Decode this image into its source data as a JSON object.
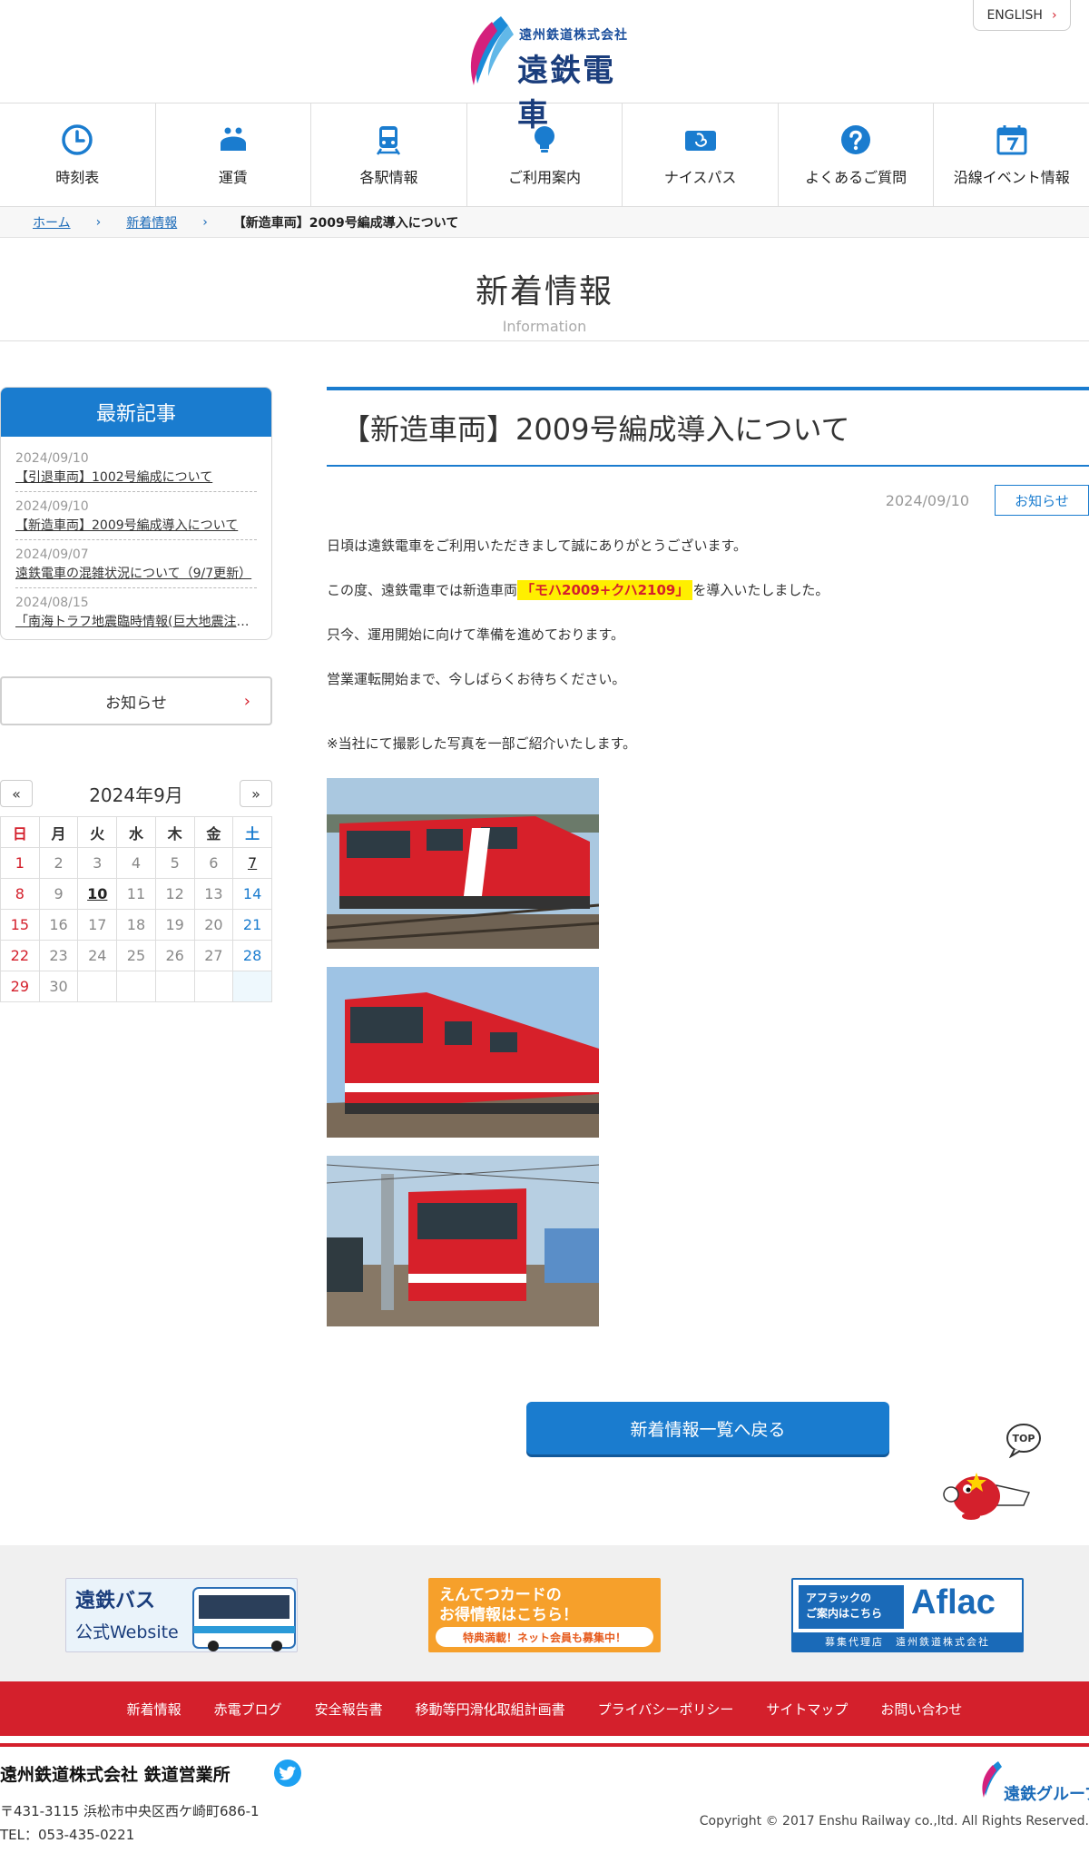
{
  "header": {
    "logo_small": "遠州鉄道株式会社",
    "logo_big": "遠鉄電車",
    "english_label": "ENGLISH"
  },
  "nav": [
    {
      "label": "時刻表",
      "icon": "clock-icon"
    },
    {
      "label": "運賃",
      "icon": "purse-icon"
    },
    {
      "label": "各駅情報",
      "icon": "train-icon"
    },
    {
      "label": "ご利用案内",
      "icon": "lightbulb-icon"
    },
    {
      "label": "ナイスパス",
      "icon": "ic-card-icon"
    },
    {
      "label": "よくあるご質問",
      "icon": "question-icon"
    },
    {
      "label": "沿線イベント情報",
      "icon": "calendar-icon"
    }
  ],
  "breadcrumb": {
    "home": "ホーム",
    "news": "新着情報",
    "current": "【新造車両】2009号編成導入について"
  },
  "page_title": {
    "title": "新着情報",
    "subtitle": "Information"
  },
  "sidebar": {
    "recent_heading": "最新記事",
    "recent": [
      {
        "date": "2024/09/10",
        "title": "【引退車両】1002号編成について"
      },
      {
        "date": "2024/09/10",
        "title": "【新造車両】2009号編成導入について"
      },
      {
        "date": "2024/09/07",
        "title": "遠鉄電車の混雑状況について（9/7更新）"
      },
      {
        "date": "2024/08/15",
        "title": "「南海トラフ地震臨時情報(巨大地震注意)」"
      }
    ],
    "category_button": "お知らせ",
    "calendar": {
      "title": "2024年9月",
      "prev": "«",
      "next": "»",
      "weekdays": [
        "日",
        "月",
        "火",
        "水",
        "木",
        "金",
        "土"
      ],
      "weeks": [
        [
          "1",
          "2",
          "3",
          "4",
          "5",
          "6",
          "7"
        ],
        [
          "8",
          "9",
          "10",
          "11",
          "12",
          "13",
          "14"
        ],
        [
          "15",
          "16",
          "17",
          "18",
          "19",
          "20",
          "21"
        ],
        [
          "22",
          "23",
          "24",
          "25",
          "26",
          "27",
          "28"
        ],
        [
          "29",
          "30",
          "",
          "",
          "",
          "",
          ""
        ]
      ]
    }
  },
  "article": {
    "title": "【新造車両】2009号編成導入について",
    "date": "2024/09/10",
    "category": "お知らせ",
    "p1": "日頃は遠鉄電車をご利用いただきまして誠にありがとうございます。",
    "p2_before": "この度、遠鉄電車では新造車両",
    "p2_highlight": "「モハ2009+クハ2109」",
    "p2_after": "を導入いたしました。",
    "p3": "只今、運用開始に向けて準備を進めております。",
    "p4": "営業運転開始まで、今しばらくお待ちください。",
    "note": "※当社にて撮影した写真を一部ご紹介いたします。",
    "back_button": "新着情報一覧へ戻る"
  },
  "top_label": "TOP",
  "banners": {
    "bus_line1": "遠鉄バス",
    "bus_line2": "公式Website",
    "card_line1": "えんてつカードの",
    "card_line2": "お得情報はこちら！",
    "card_line3": "特典満載！ネット会員も募集中！",
    "aflac_line1": "アフラックの",
    "aflac_line2": "ご案内はこちら",
    "aflac_brand": "Aflac",
    "aflac_agent": "募集代理店　遠州鉄道株式会社"
  },
  "footer_nav": [
    "新着情報",
    "赤電ブログ",
    "安全報告書",
    "移動等円滑化取組計画書",
    "プライバシーポリシー",
    "サイトマップ",
    "お問い合わせ"
  ],
  "footer": {
    "company": "遠州鉄道株式会社 鉄道営業所",
    "address": "〒431-3115 浜松市中央区西ケ崎町686-1",
    "tel": "TEL：053-435-0221",
    "group": "遠鉄グループ",
    "copyright": "Copyright © 2017 Enshu Railway co.,ltd. All Rights Reserved."
  },
  "colors": {
    "brand_blue": "#1a7ccf",
    "brand_red": "#d4202c",
    "highlight_yellow": "#ffef00"
  }
}
